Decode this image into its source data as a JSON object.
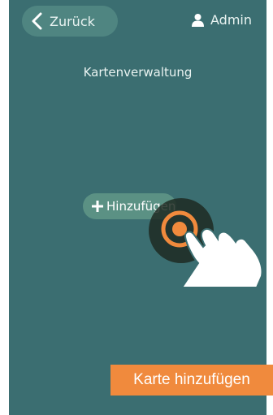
{
  "header": {
    "back_label": "Zurück",
    "user_label": "Admin"
  },
  "page": {
    "title": "Kartenverwaltung"
  },
  "main": {
    "add_button_label": "Hinzufügen"
  },
  "overlay": {
    "caption": "Karte hinzufügen"
  },
  "colors": {
    "screen_bg": "#3b6e71",
    "button_bg": "#5b9184",
    "accent": "#f08a3d"
  },
  "icons": [
    "chevron-left-icon",
    "user-icon",
    "plus-icon",
    "touch-indicator-icon",
    "pointing-hand-icon"
  ]
}
